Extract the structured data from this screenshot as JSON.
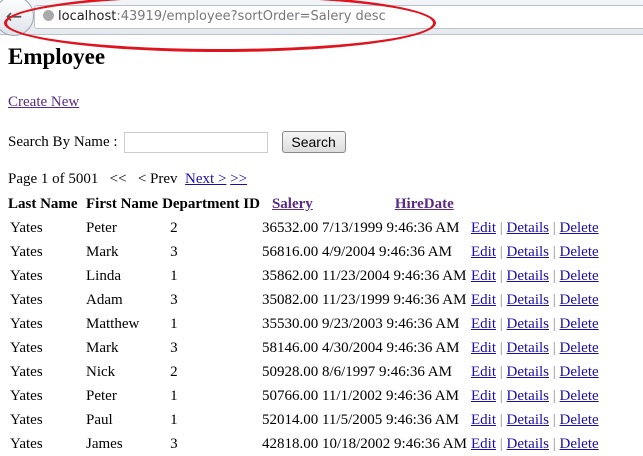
{
  "browser": {
    "url_host": "localhost",
    "url_rest": ":43919/employee?sortOrder=Salery desc"
  },
  "page": {
    "title": "Employee",
    "create_new": "Create New",
    "search_label": "Search By Name :",
    "search_value": "",
    "search_button": "Search"
  },
  "pager": {
    "info": "Page 1 of 5001",
    "first": "<<",
    "prev": "< Prev",
    "next": "Next >",
    "last": ">>"
  },
  "table": {
    "headers": [
      "Last Name",
      "First Name",
      "Department ID",
      "Salery",
      "HireDate"
    ],
    "actions": {
      "edit": "Edit",
      "details": "Details",
      "delete": "Delete",
      "sep": "|"
    },
    "rows": [
      {
        "last": "Yates",
        "first": "Peter",
        "dept": "2",
        "salary": "36532.00",
        "hire": "7/13/1999 9:46:36 AM"
      },
      {
        "last": "Yates",
        "first": "Mark",
        "dept": "3",
        "salary": "56816.00",
        "hire": "4/9/2004 9:46:36 AM"
      },
      {
        "last": "Yates",
        "first": "Linda",
        "dept": "1",
        "salary": "35862.00",
        "hire": "11/23/2004 9:46:36 AM"
      },
      {
        "last": "Yates",
        "first": "Adam",
        "dept": "3",
        "salary": "35082.00",
        "hire": "11/23/1999 9:46:36 AM"
      },
      {
        "last": "Yates",
        "first": "Matthew",
        "dept": "1",
        "salary": "35530.00",
        "hire": "9/23/2003 9:46:36 AM"
      },
      {
        "last": "Yates",
        "first": "Mark",
        "dept": "3",
        "salary": "58146.00",
        "hire": "4/30/2004 9:46:36 AM"
      },
      {
        "last": "Yates",
        "first": "Nick",
        "dept": "2",
        "salary": "50928.00",
        "hire": "8/6/1997 9:46:36 AM"
      },
      {
        "last": "Yates",
        "first": "Peter",
        "dept": "1",
        "salary": "50766.00",
        "hire": "11/1/2002 9:46:36 AM"
      },
      {
        "last": "Yates",
        "first": "Paul",
        "dept": "1",
        "salary": "52014.00",
        "hire": "11/5/2005 9:46:36 AM"
      },
      {
        "last": "Yates",
        "first": "James",
        "dept": "3",
        "salary": "42818.00",
        "hire": "10/18/2002 9:46:36 AM"
      }
    ]
  }
}
